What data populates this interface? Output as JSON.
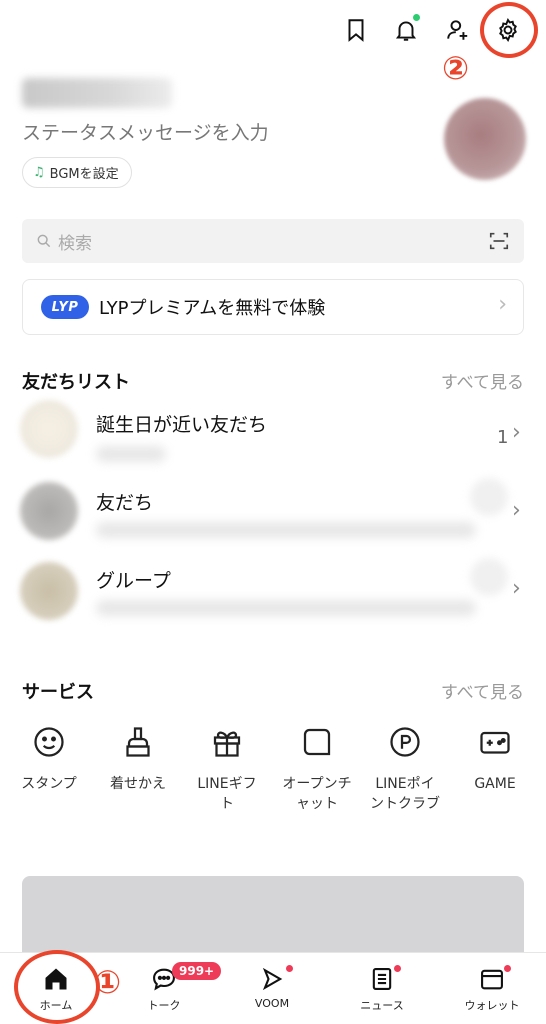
{
  "header": {
    "icons": [
      "bookmark-icon",
      "bell-icon",
      "add-friend-icon",
      "gear-icon"
    ],
    "annotation_settings": "②"
  },
  "profile": {
    "status_placeholder": "ステータスメッセージを入力",
    "bgm_label": "BGMを設定"
  },
  "search": {
    "placeholder": "検索"
  },
  "banner": {
    "logo_text": "LYP",
    "text": "LYPプレミアムを無料で体験"
  },
  "friends": {
    "title": "友だちリスト",
    "see_all": "すべて見る",
    "rows": [
      {
        "label": "誕生日が近い友だち",
        "count": "1"
      },
      {
        "label": "友だち"
      },
      {
        "label": "グループ"
      }
    ]
  },
  "services": {
    "title": "サービス",
    "see_all": "すべて見る",
    "items": [
      {
        "label": "スタンプ",
        "icon": "smiley-icon"
      },
      {
        "label": "着せかえ",
        "icon": "brush-icon"
      },
      {
        "label": "LINEギフト",
        "icon": "gift-icon"
      },
      {
        "label": "オープンチャット",
        "icon": "open-chat-icon"
      },
      {
        "label": "LINEポイントクラブ",
        "icon": "points-icon"
      },
      {
        "label": "GAME",
        "icon": "gamepad-icon"
      }
    ]
  },
  "bottom_nav": {
    "items": [
      {
        "label": "ホーム",
        "icon": "home-icon"
      },
      {
        "label": "トーク",
        "icon": "chat-icon",
        "badge": "999+"
      },
      {
        "label": "VOOM",
        "icon": "voom-icon"
      },
      {
        "label": "ニュース",
        "icon": "news-icon"
      },
      {
        "label": "ウォレット",
        "icon": "wallet-icon"
      }
    ],
    "annotation_home": "①"
  },
  "colors": {
    "annotation": "#e8452c",
    "badge": "#ee3b57",
    "lyp_blue": "#2f62e6",
    "online_dot": "#2ecc71"
  }
}
